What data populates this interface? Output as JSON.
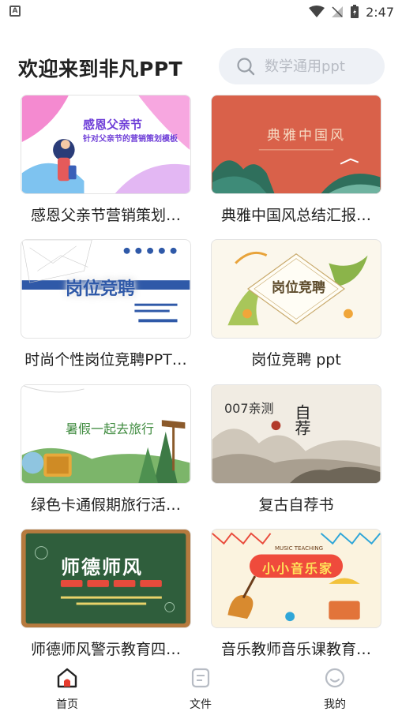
{
  "status_bar": {
    "time": "2:47",
    "left_badge": "A"
  },
  "header": {
    "title": "欢迎来到非凡PPT"
  },
  "search": {
    "placeholder": "数学通用ppt"
  },
  "cards": [
    {
      "caption": "感恩父亲节营销策划…",
      "thumb_title": "感恩父亲节",
      "thumb_subtitle": "针对父亲节的营销策划模板"
    },
    {
      "caption": "典雅中国风总结汇报…",
      "thumb_title": "典雅中国风"
    },
    {
      "caption": "时尚个性岗位竞聘PPT…",
      "thumb_title": "岗位竞聘"
    },
    {
      "caption": "岗位竞聘 ppt",
      "thumb_title": "岗位竞聘"
    },
    {
      "caption": "绿色卡通假期旅行活…",
      "thumb_title": "暑假一起去旅行"
    },
    {
      "caption": "复古自荐书",
      "thumb_title": "自荐",
      "thumb_tag": "007亲测"
    },
    {
      "caption": "师德师风警示教育四…",
      "thumb_title": "师德师风"
    },
    {
      "caption": "音乐教师音乐课教育…",
      "thumb_title": "小小音乐家",
      "thumb_tag": "MUSIC TEACHING"
    }
  ],
  "nav": [
    {
      "label": "首页",
      "icon": "home-icon",
      "active": true
    },
    {
      "label": "文件",
      "icon": "file-icon",
      "active": false
    },
    {
      "label": "我的",
      "icon": "profile-icon",
      "active": false
    }
  ],
  "colors": {
    "accent": "#e63b2e",
    "search_bg": "#eef1f6",
    "text": "#222222"
  }
}
